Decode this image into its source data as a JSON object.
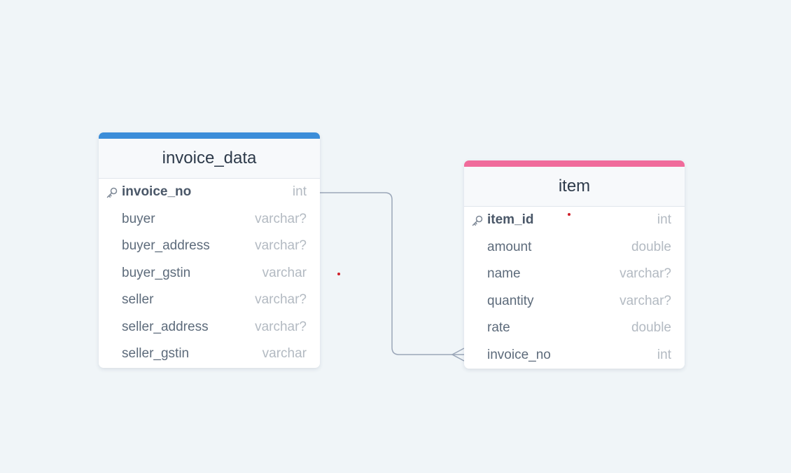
{
  "colors": {
    "background": "#f0f5f8",
    "invoice_accent": "#3b8dd9",
    "item_accent": "#f06b9b",
    "connector": "#9aa6b8",
    "marker": "#d0202a"
  },
  "tables": {
    "invoice_data": {
      "title": "invoice_data",
      "rows": [
        {
          "name": "invoice_no",
          "type": "int",
          "primary_key": true
        },
        {
          "name": "buyer",
          "type": "varchar?",
          "primary_key": false
        },
        {
          "name": "buyer_address",
          "type": "varchar?",
          "primary_key": false
        },
        {
          "name": "buyer_gstin",
          "type": "varchar",
          "primary_key": false
        },
        {
          "name": "seller",
          "type": "varchar?",
          "primary_key": false
        },
        {
          "name": "seller_address",
          "type": "varchar?",
          "primary_key": false
        },
        {
          "name": "seller_gstin",
          "type": "varchar",
          "primary_key": false
        }
      ]
    },
    "item": {
      "title": "item",
      "rows": [
        {
          "name": "item_id",
          "type": "int",
          "primary_key": true
        },
        {
          "name": "amount",
          "type": "double",
          "primary_key": false
        },
        {
          "name": "name",
          "type": "varchar?",
          "primary_key": false
        },
        {
          "name": "quantity",
          "type": "varchar?",
          "primary_key": false
        },
        {
          "name": "rate",
          "type": "double",
          "primary_key": false
        },
        {
          "name": "invoice_no",
          "type": "int",
          "primary_key": false
        }
      ]
    }
  },
  "relationship": {
    "from": "invoice_data.invoice_no",
    "to": "item.invoice_no",
    "from_cardinality": "one",
    "to_cardinality": "many"
  },
  "icons": {
    "primary_key": "key-icon",
    "many_end": "crow-foot-icon"
  }
}
